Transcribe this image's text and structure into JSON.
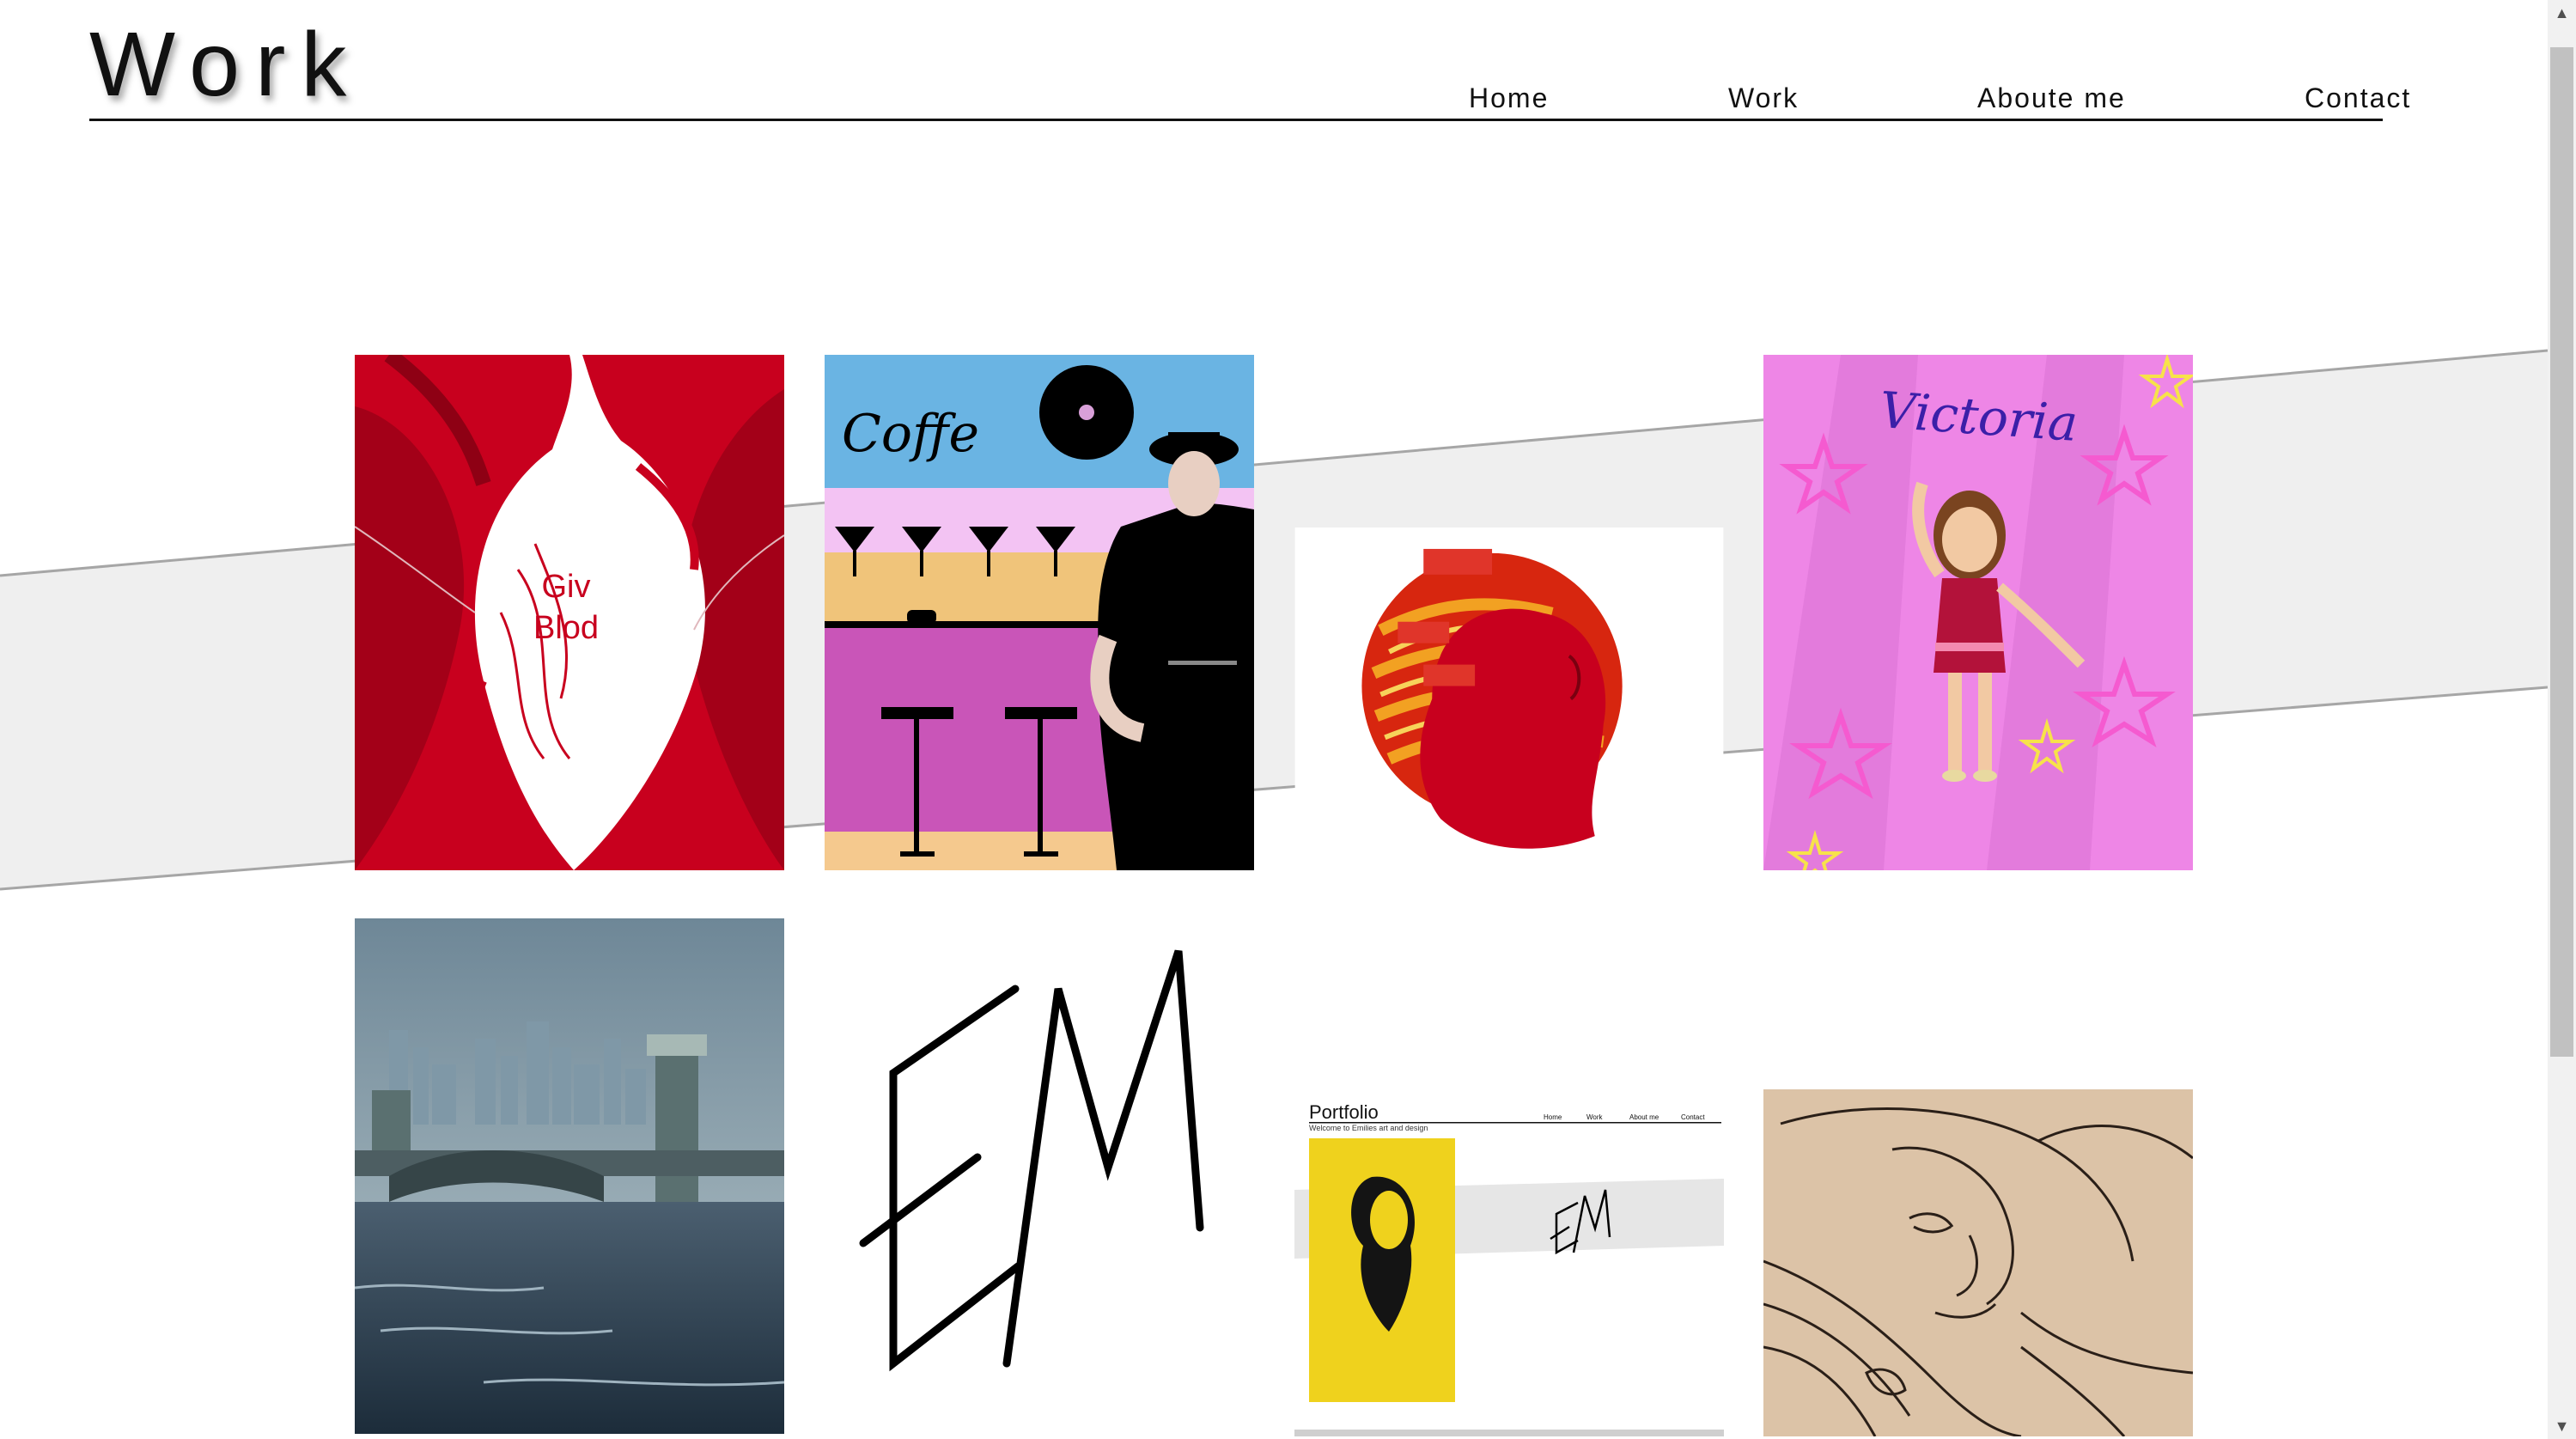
{
  "header": {
    "title": "Work"
  },
  "nav": [
    {
      "label": "Home"
    },
    {
      "label": "Work"
    },
    {
      "label": "Aboute me"
    },
    {
      "label": "Contact"
    }
  ],
  "gallery": {
    "giv_blod": {
      "line1": "Giv",
      "line2": "Blod"
    },
    "coffee": {
      "sign": "Coffe"
    },
    "victoria": {
      "title": "Victoria"
    },
    "em_logo": {
      "letters": "EM"
    },
    "portfolio": {
      "title": "Portfolio",
      "subtitle": "Welcome to Emilies art and design",
      "nav": [
        "Home",
        "Work",
        "About me",
        "Contact"
      ],
      "logo": "EM"
    }
  },
  "colors": {
    "band": "#efefef",
    "blood_red": "#c8001e",
    "text": "#111111"
  },
  "scrollbar": {
    "up_icon": "arrow-up-icon",
    "down_icon": "arrow-down-icon"
  }
}
